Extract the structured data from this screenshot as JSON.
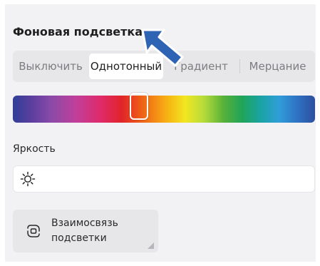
{
  "header": {
    "title": "Фоновая подсветка"
  },
  "mode_tabs": {
    "items": [
      {
        "label": "Выключить",
        "active": false
      },
      {
        "label": "Однотонный",
        "active": true
      },
      {
        "label": "Градиент",
        "active": false
      },
      {
        "label": "Мерцание",
        "active": false
      }
    ]
  },
  "color_slider": {
    "selected_position": 0.41
  },
  "brightness": {
    "label": "Яркость",
    "icon": "sun-icon"
  },
  "link_button": {
    "label": "Взаимосвязь подсветки",
    "icon": "link-icon"
  },
  "annotation": {
    "icon": "pointer-arrow-icon",
    "color": "#2f63b3"
  }
}
